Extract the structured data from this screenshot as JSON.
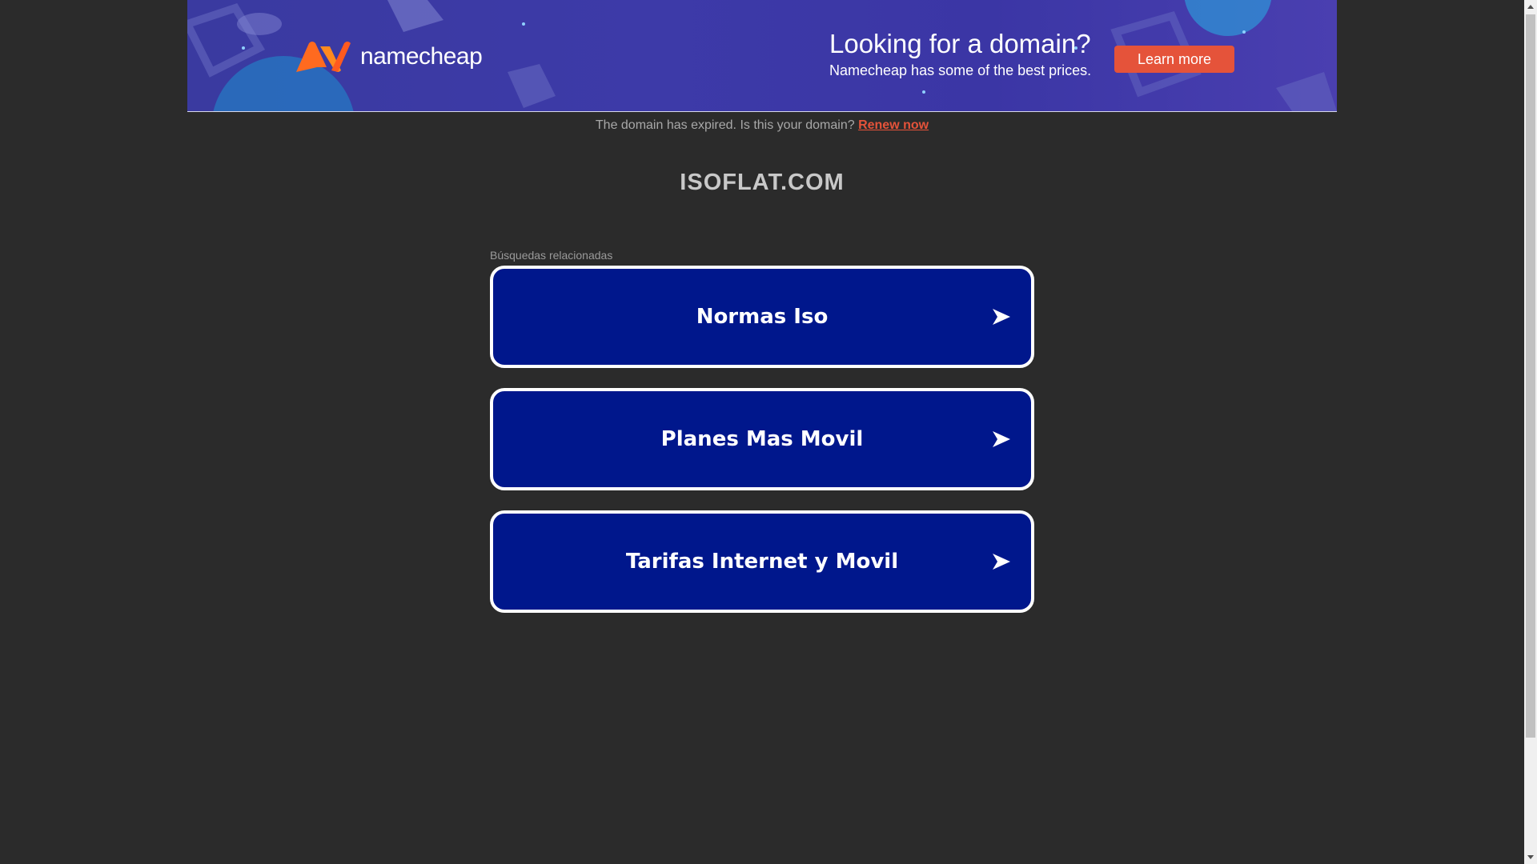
{
  "banner": {
    "brand": "namecheap",
    "headline": "Looking for a domain?",
    "subline": "Namecheap has some of the best prices.",
    "cta_label": "Learn more",
    "colors": {
      "background": "#3b39a3",
      "accent": "#e5533a",
      "logo_orange": "#ff6a1f"
    }
  },
  "notice": {
    "text": "The domain has expired. Is this your domain?",
    "link_label": "Renew now"
  },
  "domain": "ISOFLAT.COM",
  "related": {
    "label": "Búsquedas relacionadas",
    "items": [
      {
        "label": "Normas Iso",
        "icon": "arrow-right-icon"
      },
      {
        "label": "Planes Mas Movil",
        "icon": "arrow-right-icon"
      },
      {
        "label": "Tarifas Internet y Movil",
        "icon": "arrow-right-icon"
      }
    ]
  },
  "colors": {
    "page_background": "#2b2b2b",
    "button_background": "#00178c",
    "button_border": "#ffffff"
  }
}
